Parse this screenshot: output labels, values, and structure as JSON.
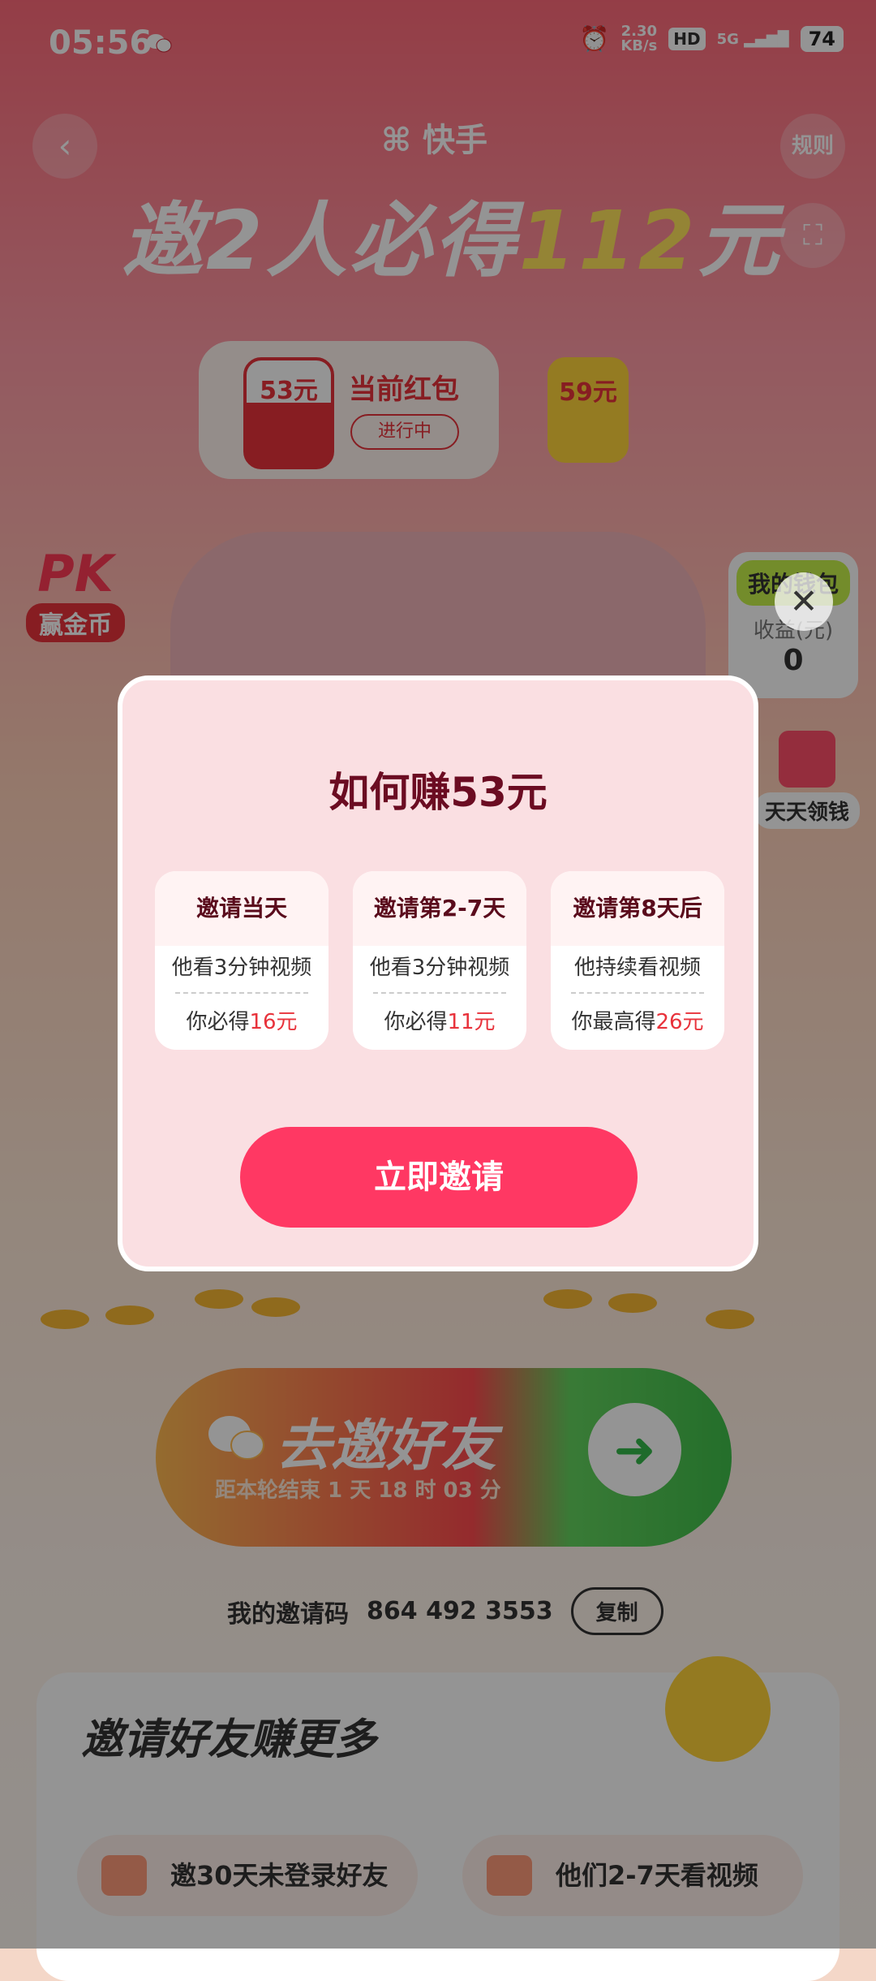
{
  "status_bar": {
    "time": "05:56",
    "speed": "2.30",
    "speed_unit": "KB/s",
    "hd": "HD",
    "network": "5G",
    "battery": "74"
  },
  "header": {
    "app_name": "快手",
    "rules": "规则",
    "headline_prefix": "邀2人必得",
    "headline_amount": "112",
    "headline_suffix": "元"
  },
  "packets": {
    "current_amount": "53元",
    "current_title": "当前红包",
    "current_status": "进行中",
    "next_amount": "59元"
  },
  "side": {
    "pk_logo": "PK",
    "pk_label": "赢金币",
    "wallet_title": "我的钱包",
    "wallet_sub": "收益(元)",
    "wallet_value": "0",
    "daily_label": "天天领钱"
  },
  "invite_banner": {
    "title": "去邀好友",
    "countdown": "距本轮结束 1 天 18 时 03 分"
  },
  "invite_code": {
    "label": "我的邀请码",
    "code": "864 492 3553",
    "copy": "复制"
  },
  "earn_more": {
    "title": "邀请好友赚更多",
    "items": [
      {
        "label": "邀30天未登录好友"
      },
      {
        "label": "他们2-7天看视频"
      }
    ]
  },
  "modal": {
    "title": "如何赚53元",
    "steps": [
      {
        "head": "邀请当天",
        "line1": "他看3分钟视频",
        "line2_prefix": "你必得",
        "amount": "16元"
      },
      {
        "head": "邀请第2-7天",
        "line1": "他看3分钟视频",
        "line2_prefix": "你必得",
        "amount": "11元"
      },
      {
        "head": "邀请第8天后",
        "line1": "他持续看视频",
        "line2_prefix": "你最高得",
        "amount": "26元"
      }
    ],
    "button": "立即邀请"
  },
  "colors": {
    "accent": "#ff3863",
    "modal_bg": "#fadfe2",
    "title": "#6b0c22",
    "amount_red": "#e8323b"
  }
}
